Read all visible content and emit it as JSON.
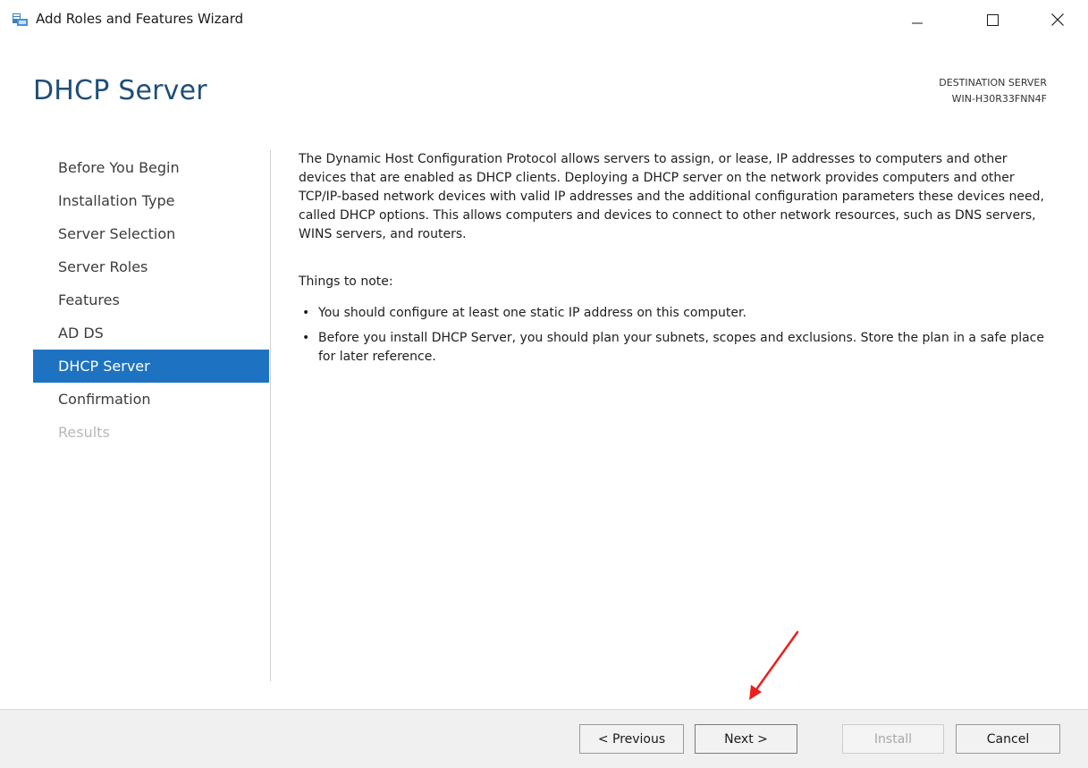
{
  "window": {
    "title": "Add Roles and Features Wizard"
  },
  "header": {
    "page_title": "DHCP Server",
    "destination_label": "DESTINATION SERVER",
    "destination_value": "WIN-H30R33FNN4F"
  },
  "nav": {
    "items": [
      {
        "label": "Before You Begin",
        "state": "normal"
      },
      {
        "label": "Installation Type",
        "state": "normal"
      },
      {
        "label": "Server Selection",
        "state": "normal"
      },
      {
        "label": "Server Roles",
        "state": "normal"
      },
      {
        "label": "Features",
        "state": "normal"
      },
      {
        "label": "AD DS",
        "state": "normal"
      },
      {
        "label": "DHCP Server",
        "state": "active"
      },
      {
        "label": "Confirmation",
        "state": "normal"
      },
      {
        "label": "Results",
        "state": "disabled"
      }
    ]
  },
  "content": {
    "intro": "The Dynamic Host Configuration Protocol allows servers to assign, or lease, IP addresses to computers and other devices that are enabled as DHCP clients. Deploying a DHCP server on the network provides computers and other TCP/IP-based network devices with valid IP addresses and the additional configuration parameters these devices need, called DHCP options. This allows computers and devices to connect to other network resources, such as DNS servers, WINS servers, and routers.",
    "note_heading": "Things to note:",
    "bullet_glyph": "•",
    "bullets": [
      "You should configure at least one static IP address on this computer.",
      "Before you install DHCP Server, you should plan your subnets, scopes and exclusions. Store the plan in a safe place for later reference."
    ]
  },
  "footer": {
    "previous_label": "< Previous",
    "next_label": "Next >",
    "install_label": "Install",
    "cancel_label": "Cancel"
  },
  "colors": {
    "accent": "#1e72c2",
    "title": "#1f4e79",
    "annotation_arrow": "#e8201f"
  },
  "icons": {
    "app": "server-manager-icon",
    "minimize": "minimize-icon",
    "maximize": "maximize-icon",
    "close": "close-icon"
  }
}
